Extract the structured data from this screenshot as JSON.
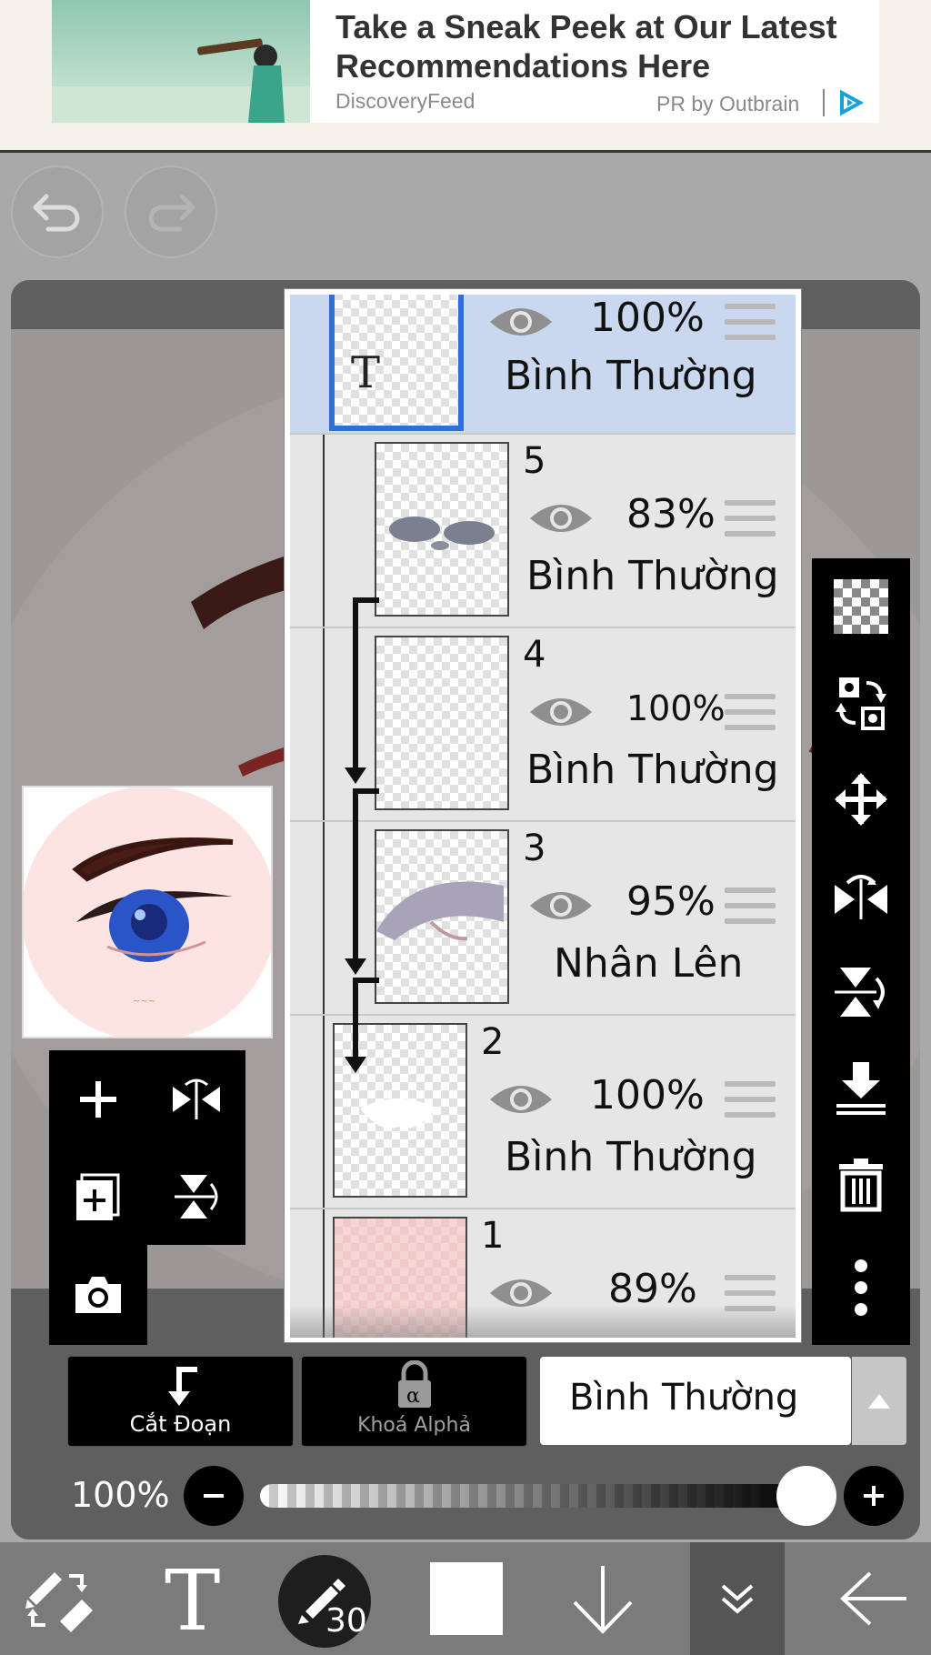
{
  "ad": {
    "title": "Take a Sneak Peek at Our Latest Recommendations Here",
    "source": "DiscoveryFeed",
    "sponsor": "PR by Outbrain"
  },
  "history": {
    "undo_icon": "undo-icon",
    "redo_icon": "redo-icon"
  },
  "layers": [
    {
      "name": "",
      "opacity": "100%",
      "blend": "Bình Thường",
      "selected": true,
      "type": "text"
    },
    {
      "name": "5",
      "opacity": "83%",
      "blend": "Bình Thường",
      "clipped": true
    },
    {
      "name": "4",
      "opacity": "100%",
      "blend": "Bình Thường",
      "clipped": true
    },
    {
      "name": "3",
      "opacity": "95%",
      "blend": "Nhân Lên",
      "clipped": true
    },
    {
      "name": "2",
      "opacity": "100%",
      "blend": "Bình Thường"
    },
    {
      "name": "1",
      "opacity": "89%",
      "blend": ""
    }
  ],
  "right_tools": [
    "transparency-icon",
    "swap-layer-icon",
    "move-icon",
    "flip-horizontal-icon",
    "flip-vertical-icon",
    "merge-down-icon",
    "trash-icon",
    "more-icon"
  ],
  "left_tools": [
    "add-layer-icon",
    "flip-horizontal-icon",
    "duplicate-layer-icon",
    "flip-vertical-icon",
    "camera-icon"
  ],
  "blend_controls": {
    "clipping_label": "Cắt Đoạn",
    "alpha_lock_label": "Khoá Alphả",
    "blend_mode": "Bình Thường"
  },
  "opacity_slider": {
    "label": "100%",
    "value": 1.0
  },
  "toolbar": {
    "brush_size": "30",
    "color": "#ffffff"
  },
  "colors": {
    "selection_blue": "#2e6fd8",
    "selected_row": "#c9d8ee"
  }
}
